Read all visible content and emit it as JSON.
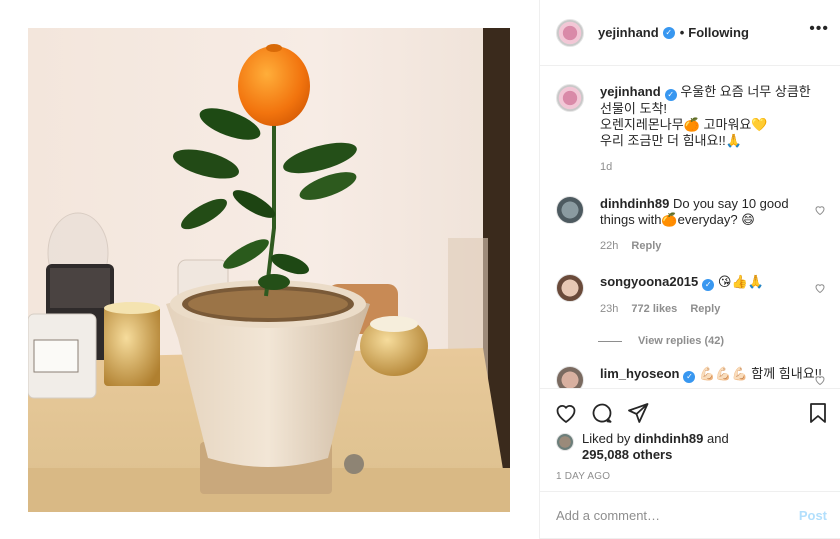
{
  "header": {
    "username": "yejinhand",
    "dot": "•",
    "following": "Following",
    "more": "•••"
  },
  "caption": {
    "username": "yejinhand",
    "text": "우울한 요즘 너무 상큼한 선물이 도착!",
    "line2": "오렌지레몬나무🍊 고마워요💛",
    "line3": "우리 조금만 더 힘내요!!🙏",
    "age": "1d"
  },
  "comments": [
    {
      "username": "dinhdinh89",
      "text": "Do you say 10 good things with🍊everyday? 😄",
      "age": "22h",
      "likes": "",
      "reply": "Reply"
    },
    {
      "username": "songyoona2015",
      "text": "😘👍🙏",
      "age": "23h",
      "likes": "772 likes",
      "reply": "Reply"
    },
    {
      "username": "lim_hyoseon",
      "text": "💪🏻💪🏻💪🏻 함께 힘내요!!",
      "age": "",
      "likes": "",
      "reply": ""
    }
  ],
  "view_replies": "View replies (42)",
  "likes": {
    "prefix": "Liked by ",
    "user": "dinhdinh89",
    "and": " and",
    "others": "295,088 others"
  },
  "timestamp": "1 DAY AGO",
  "add_comment": {
    "placeholder": "Add a comment…",
    "post_label": "Post"
  },
  "colors": {
    "verified": "#3897f0",
    "post_disabled": "#b2dffc",
    "muted": "#8e8e8e"
  },
  "icons": [
    "heart-icon",
    "comment-icon",
    "share-icon",
    "bookmark-icon"
  ]
}
